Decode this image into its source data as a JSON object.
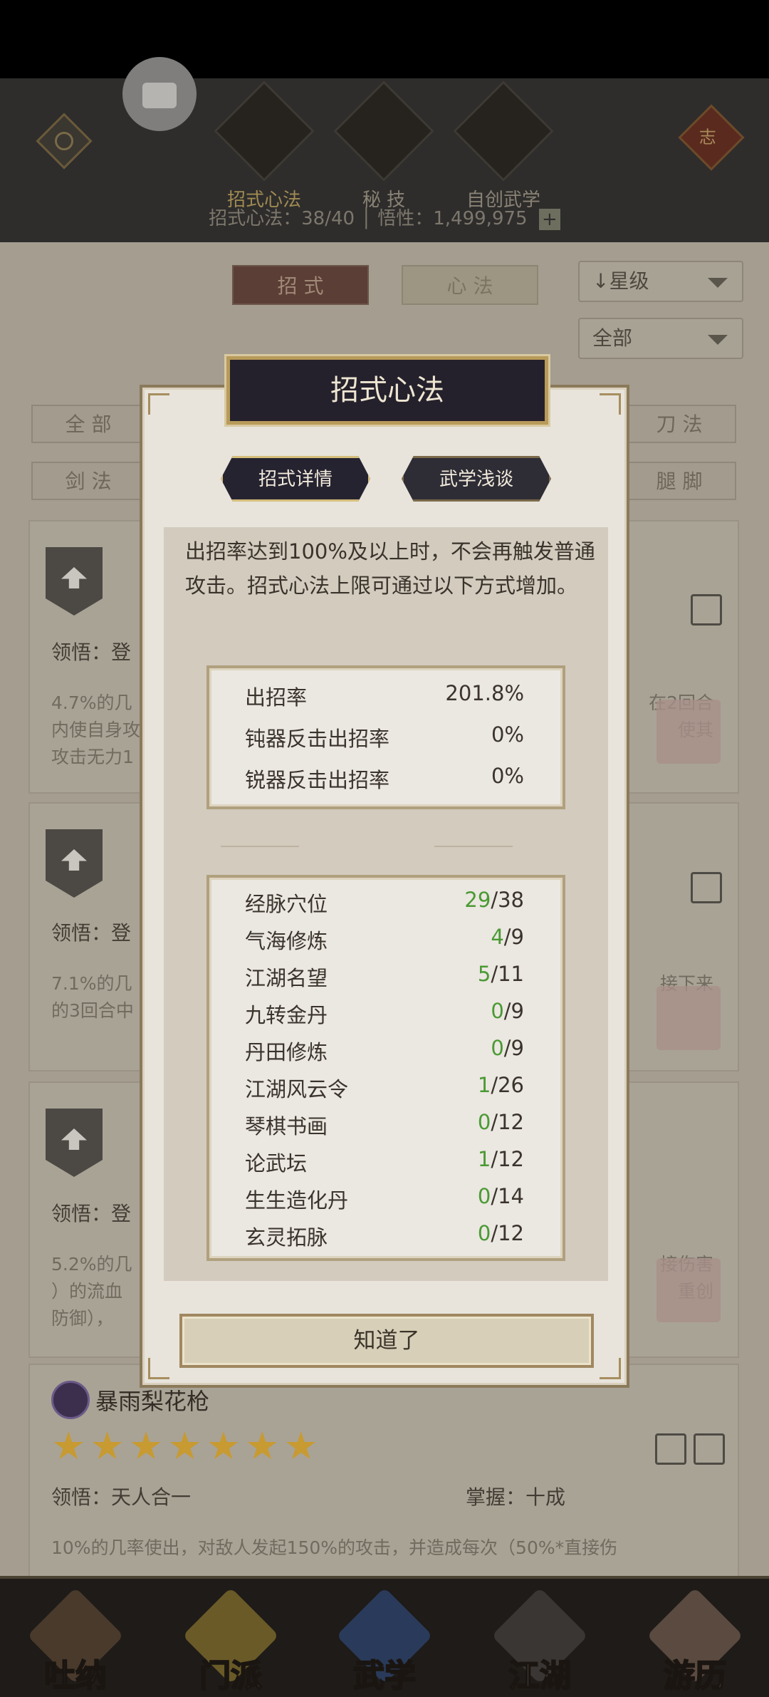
{
  "top": {
    "tabs": [
      {
        "label": "招式心法",
        "icon": "sword-icon"
      },
      {
        "label": "秘 技",
        "icon": "book-icon"
      },
      {
        "label": "自创武学",
        "icon": "scroll-icon"
      }
    ],
    "stat_line": "招式心法：38/40 │ 悟性：1,499,975",
    "plus": "+",
    "hanger_char": "志"
  },
  "controls": {
    "seg_moves": "招 式",
    "seg_mind": "心 法",
    "sort_select": "↓星级",
    "filter_select": "全部"
  },
  "filters": {
    "all": "全 部",
    "saber": "刀 法",
    "sword": "剑 法",
    "leg": "腿 脚"
  },
  "cards": [
    {
      "ling": "领悟：登",
      "desc1": "4.7%的几",
      "desc1r": "在2回合",
      "desc2": "内使自身攻",
      "desc2r": "使其",
      "desc3": "攻击无力1"
    },
    {
      "ling": "领悟：登",
      "desc1": "7.1%的几",
      "desc1r": "接下来",
      "desc2": "的3回合中"
    },
    {
      "ling": "领悟：登",
      "desc1": "5.2%的几",
      "desc1r": "接伤害",
      "desc2": "）的流血",
      "desc2r": "重创",
      "desc3": "防御），"
    }
  ],
  "last_card": {
    "name": "暴雨梨花枪",
    "stars": "★★★★★★★",
    "ling": "领悟：天人合一",
    "master": "掌握：十成",
    "desc": "10%的几率使出，对敌人发起150%的攻击，并造成每次（50%*直接伤"
  },
  "nav": [
    {
      "label": "吐纳"
    },
    {
      "label": "门派"
    },
    {
      "label": "武学"
    },
    {
      "label": "江湖"
    },
    {
      "label": "游历"
    }
  ],
  "dialog": {
    "title": "招式心法",
    "tab_detail": "招式详情",
    "tab_talk": "武学浅谈",
    "intro": "出招率达到100%及以上时，不会再触发普通攻击。招式心法上限可通过以下方式增加。",
    "rates": [
      {
        "name": "出招率",
        "value": "201.8%"
      },
      {
        "name": "钝器反击出招率",
        "value": "0%"
      },
      {
        "name": "锐器反击出招率",
        "value": "0%"
      }
    ],
    "sources": [
      {
        "name": "经脉穴位",
        "cur": "29",
        "max": "/38"
      },
      {
        "name": "气海修炼",
        "cur": "4",
        "max": "/9"
      },
      {
        "name": "江湖名望",
        "cur": "5",
        "max": "/11"
      },
      {
        "name": "九转金丹",
        "cur": "0",
        "max": "/9"
      },
      {
        "name": "丹田修炼",
        "cur": "0",
        "max": "/9"
      },
      {
        "name": "江湖风云令",
        "cur": "1",
        "max": "/26"
      },
      {
        "name": "琴棋书画",
        "cur": "0",
        "max": "/12"
      },
      {
        "name": "论武坛",
        "cur": "1",
        "max": "/12"
      },
      {
        "name": "生生造化丹",
        "cur": "0",
        "max": "/14"
      },
      {
        "name": "玄灵拓脉",
        "cur": "0",
        "max": "/12"
      }
    ],
    "ok_label": "知道了"
  }
}
